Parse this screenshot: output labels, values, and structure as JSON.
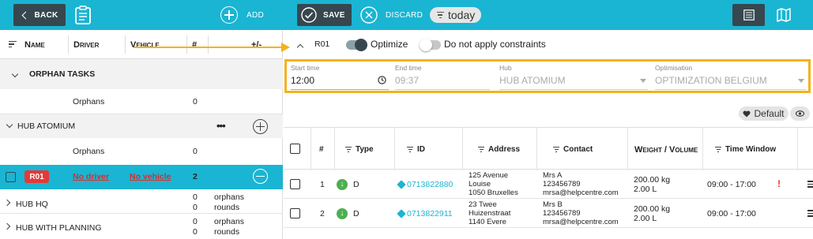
{
  "topbar": {
    "back_label": "BACK",
    "add_label": "ADD",
    "save_label": "SAVE",
    "discard_label": "DISCARD",
    "today_label": "today",
    "bg_color": "#1ab5d3",
    "dark_color": "#37474f"
  },
  "left": {
    "columns": [
      "Name",
      "Driver",
      "Vehicle",
      "#",
      "+/-"
    ],
    "orphan_group": "ORPHAN TASKS",
    "orphans_label": "Orphans",
    "orphans_count": "0",
    "hub_atomium": "HUB ATOMIUM",
    "atomium_orphans_label": "Orphans",
    "atomium_orphans_count": "0",
    "ellipsis": "•••",
    "route": {
      "name": "R01",
      "driver": "No driver",
      "vehicle": "No vehicle",
      "count": "2"
    },
    "hub_hq": {
      "name": "HUB HQ",
      "orphans_count": "0",
      "orphans_label": "orphans",
      "rounds_count": "0",
      "rounds_label": "rounds"
    },
    "hub_planning": {
      "name": "HUB WITH PLANNING",
      "orphans_count": "0",
      "orphans_label": "orphans",
      "rounds_count": "0",
      "rounds_label": "rounds"
    }
  },
  "route_panel": {
    "title": "R01",
    "optimize_label": "Optimize",
    "optimize_on": true,
    "constraints_label": "Do not apply constraints",
    "constraints_on": false,
    "fields": {
      "start_label": "Start time",
      "start_value": "12:00",
      "end_label": "End time",
      "end_value": "09:37",
      "hub_label": "Hub",
      "hub_value": "HUB ATOMIUM",
      "optim_label": "Optimisation",
      "optim_value": "OPTIMIZATION BELGIUM"
    },
    "default_label": "Default"
  },
  "table": {
    "headers": {
      "num": "#",
      "type": "Type",
      "id": "ID",
      "address": "Address",
      "contact": "Contact",
      "weight": "Weight / Volume",
      "window": "Time Window"
    },
    "rows": [
      {
        "num": "1",
        "type": "D",
        "id": "0713822880",
        "addr1": "125 Avenue",
        "addr2": "Louise",
        "addr3": "1050 Bruxelles",
        "contact1": "Mrs A",
        "contact2": "123456789",
        "contact3": "mrsa@helpcentre.com",
        "weight": "200.00 kg",
        "volume": "2.00 L",
        "window": "09:00 - 17:00",
        "warning": "!"
      },
      {
        "num": "2",
        "type": "D",
        "id": "0713822911",
        "addr1": "23 Twee",
        "addr2": "Huizenstraat",
        "addr3": "1140 Evere",
        "contact1": "Mrs B",
        "contact2": "123456789",
        "contact3": "mrsa@helpcentre.com",
        "weight": "200.00 kg",
        "volume": "2.00 L",
        "window": "09:00 - 17:00",
        "warning": ""
      }
    ]
  }
}
